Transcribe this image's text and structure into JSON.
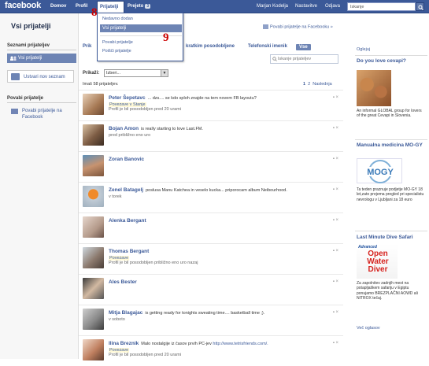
{
  "topbar": {
    "logo": "facebook",
    "nav": [
      "Domov",
      "Profil",
      "Prijatelji",
      "Prejeto"
    ],
    "inbox_count": "3",
    "right": [
      "Marjan Kodelja",
      "Nastavitve",
      "Odjava"
    ],
    "search_placeholder": "Iskanje"
  },
  "page": {
    "title": "Vsi prijatelji",
    "invite_top": "Povabi prijatelje na Facebooku »"
  },
  "left": {
    "header1": "Seznami prijateljev",
    "all": "Vsi prijatelji",
    "create": "Ustvari nov seznam",
    "header2": "Povabi prijatelje",
    "invite": "Povabi prijatelje na Facebook"
  },
  "tabs": {
    "t1": "Prik",
    "t2": "kratkim posodobljene",
    "t3": "Telefonski imenik",
    "all": "Vse",
    "search_placeholder": "Iskanje prijateljev"
  },
  "filter": {
    "label": "Prikaži:",
    "value": "Izberi..."
  },
  "count": "Imaš 58 prijateljev.",
  "pager": {
    "p1": "1",
    "p2": "2",
    "next": "Naslednja"
  },
  "dropdown": {
    "items": [
      "Nedavno dodan",
      "Vsi prijatelji",
      "Povabi prijatelje",
      "Poišči prijatelje"
    ]
  },
  "callouts": {
    "a": "8",
    "b": "9"
  },
  "friends": [
    {
      "name": "Peter Šepetavc",
      "status": "... dzs.... se kdo sploh znajde na tem novem FB layoutu?",
      "tag": "Povezave v Stanje",
      "sub": "Profil je bil posodobljen pred 20 urami"
    },
    {
      "name": "Bojan Amon",
      "status": "is really starting to love Last.FM.",
      "tag": "",
      "sub": "pred približno eno uro"
    },
    {
      "name": "Zoran Banovic",
      "status": "",
      "tag": "",
      "sub": ""
    },
    {
      "name": "Zenel Batagelj",
      "status": "poslusa Manu Katchea in veselo kucka... priporocam album Neibourhood.",
      "tag": "",
      "sub": "v torek"
    },
    {
      "name": "Alenka Bergant",
      "status": "",
      "tag": "",
      "sub": ""
    },
    {
      "name": "Thomas Bergant",
      "status": "",
      "tag": "Povezave",
      "sub": "Profil je bil posodobljen približno eno uro nazaj"
    },
    {
      "name": "Ales Bester",
      "status": "",
      "tag": "",
      "sub": ""
    },
    {
      "name": "Mitja Blagajac",
      "status": "is getting ready for tonights sweating time.... basketball time ;).",
      "tag": "",
      "sub": "v soboto"
    },
    {
      "name": "Ilina Breznik",
      "status": "Malo nostalgije iz časov prvih PC-jev",
      "link": "http://www.tetrisfriends.com/.",
      "tag": "Povezave",
      "sub": "Profil je bil posodobljen pred 20 urami"
    }
  ],
  "ads": {
    "label": "Oglejuj",
    "a1_title": "Do you love cevapi?",
    "a1_text": "An informal GLOBAL group for lovers of the great Cevapi in Slovenia.",
    "a2_title": "Manualna medicina MO-GY",
    "a2_logo": "MOGY",
    "a2_text": "Ta teden praznuje podjetje MO-GY 18 let,zato prejema pregled pri specialistu nevrologu v Ljubljani za 18 euro",
    "a3_title": "Last Minute Dive Safari",
    "a3_logo1": "Advanced",
    "a3_logo2": "Open Water Diver",
    "a3_text": "Za zapolnitev zadnjih mest na potapljaškem safariju v Egiptu ponujamo BREZPLAČNI AOWD ali NITROX tečaj.",
    "more": "Več oglasov"
  },
  "colors": {
    "brand": "#3b5998",
    "callout": "#cc0000"
  }
}
